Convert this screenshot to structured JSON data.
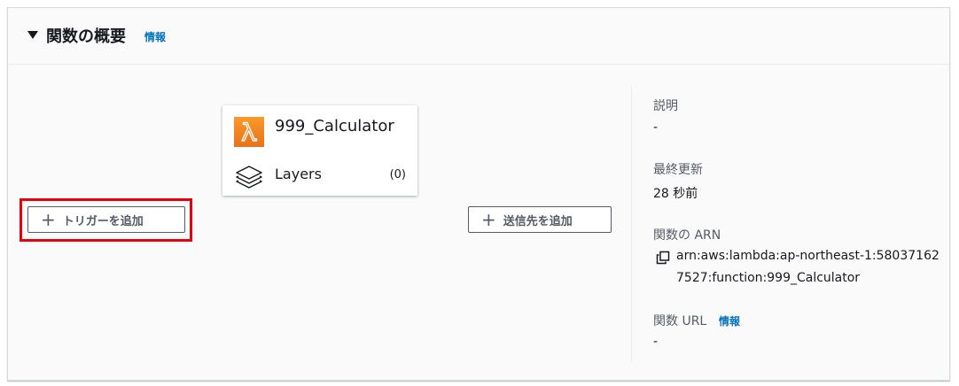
{
  "header": {
    "title": "関数の概要",
    "info_link": "情報"
  },
  "diagram": {
    "add_trigger_label": "トリガーを追加",
    "add_destination_label": "送信先を追加",
    "function_name": "999_Calculator",
    "layers_label": "Layers",
    "layers_count": "(0)"
  },
  "details": {
    "description_label": "説明",
    "description_value": "-",
    "last_modified_label": "最終更新",
    "last_modified_value": "28 秒前",
    "arn_label": "関数の ARN",
    "arn_value": "arn:aws:lambda:ap-northeast-1:580371627527:function:999_Calculator",
    "url_label": "関数 URL",
    "url_info_link": "情報",
    "url_value": "-"
  },
  "colors": {
    "accent": "#0073bb",
    "highlight": "#e8000b",
    "lambda_orange": "#ed7f20"
  },
  "icons": {
    "caret": "caret-down-icon",
    "plus": "plus-icon",
    "lambda": "lambda-icon",
    "layers": "layers-icon",
    "copy": "copy-icon"
  }
}
